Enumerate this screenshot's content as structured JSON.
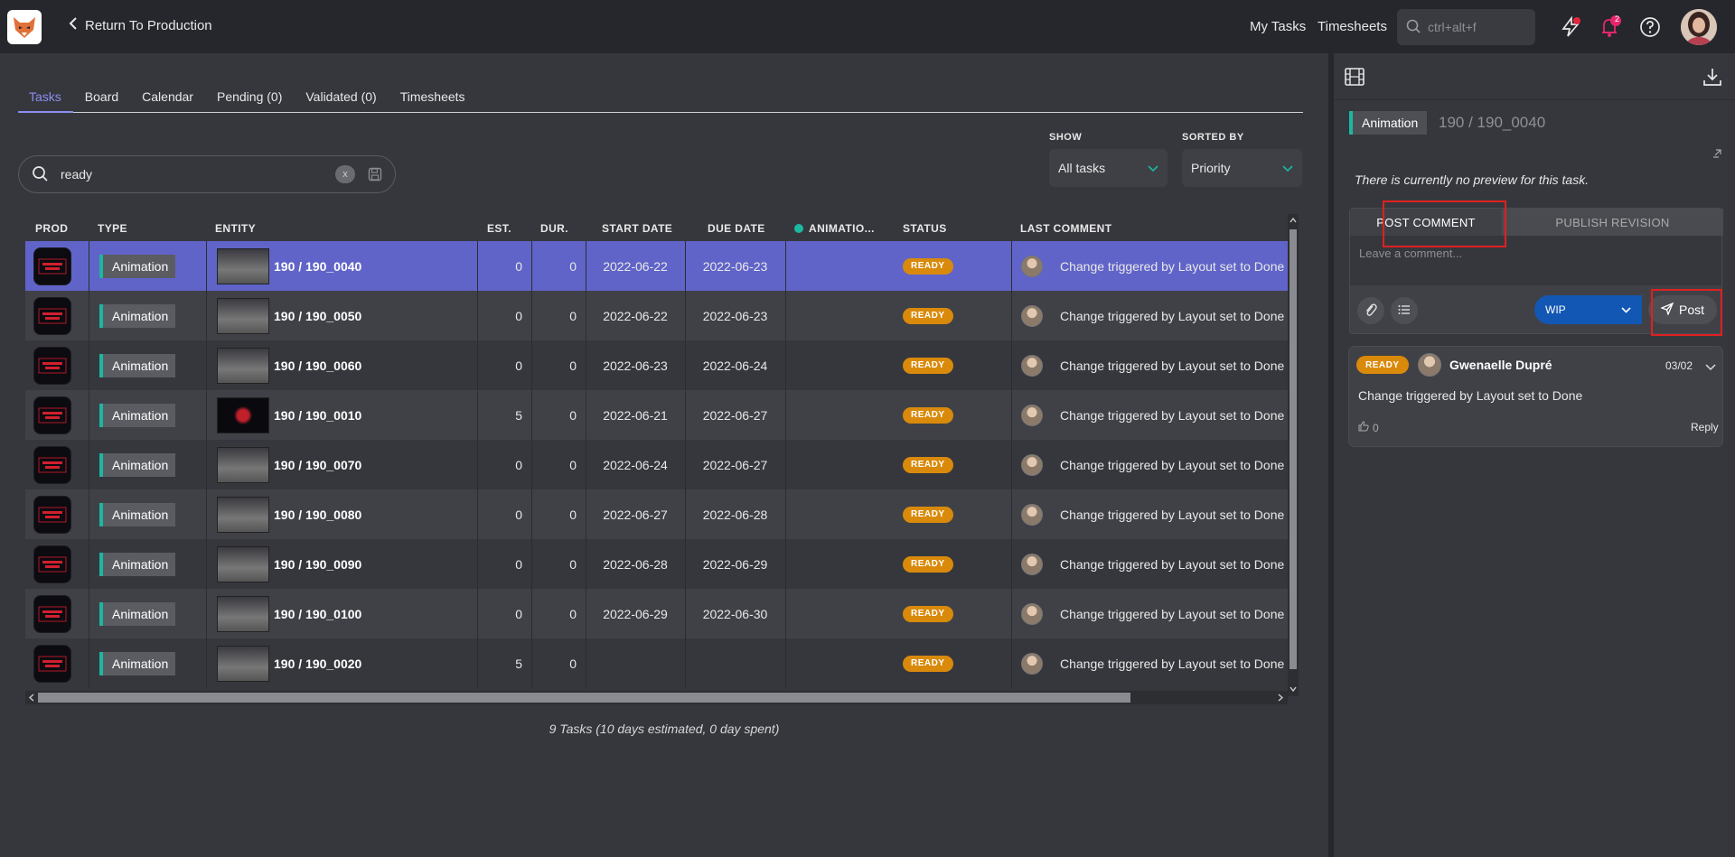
{
  "topbar": {
    "back_label": "Return To Production",
    "my_tasks": "My Tasks",
    "timesheets": "Timesheets",
    "search_placeholder": "ctrl+alt+f",
    "notification_count": "2"
  },
  "tabs": [
    "Tasks",
    "Board",
    "Calendar",
    "Pending (0)",
    "Validated (0)",
    "Timesheets"
  ],
  "filter": {
    "value": "ready",
    "clear": "x"
  },
  "show": {
    "label": "SHOW",
    "value": "All tasks"
  },
  "sorted": {
    "label": "SORTED BY",
    "value": "Priority"
  },
  "columns": {
    "prod": "PROD",
    "type": "TYPE",
    "entity": "ENTITY",
    "est": "EST.",
    "dur": "DUR.",
    "start": "START DATE",
    "due": "DUE DATE",
    "anim": "ANIMATIO...",
    "status": "STATUS",
    "last_comment": "LAST COMMENT"
  },
  "rows": [
    {
      "type": "Animation",
      "entity": "190 / 190_0040",
      "est": "0",
      "dur": "0",
      "start": "2022-06-22",
      "due": "2022-06-23",
      "status": "READY",
      "comment": "Change triggered by Layout set to Done",
      "thumb": "grey"
    },
    {
      "type": "Animation",
      "entity": "190 / 190_0050",
      "est": "0",
      "dur": "0",
      "start": "2022-06-22",
      "due": "2022-06-23",
      "status": "READY",
      "comment": "Change triggered by Layout set to Done",
      "thumb": "grey"
    },
    {
      "type": "Animation",
      "entity": "190 / 190_0060",
      "est": "0",
      "dur": "0",
      "start": "2022-06-23",
      "due": "2022-06-24",
      "status": "READY",
      "comment": "Change triggered by Layout set to Done",
      "thumb": "grey"
    },
    {
      "type": "Animation",
      "entity": "190 / 190_0010",
      "est": "5",
      "dur": "0",
      "start": "2022-06-21",
      "due": "2022-06-27",
      "status": "READY",
      "comment": "Change triggered by Layout set to Done",
      "thumb": "black"
    },
    {
      "type": "Animation",
      "entity": "190 / 190_0070",
      "est": "0",
      "dur": "0",
      "start": "2022-06-24",
      "due": "2022-06-27",
      "status": "READY",
      "comment": "Change triggered by Layout set to Done",
      "thumb": "grey"
    },
    {
      "type": "Animation",
      "entity": "190 / 190_0080",
      "est": "0",
      "dur": "0",
      "start": "2022-06-27",
      "due": "2022-06-28",
      "status": "READY",
      "comment": "Change triggered by Layout set to Done",
      "thumb": "grey"
    },
    {
      "type": "Animation",
      "entity": "190 / 190_0090",
      "est": "0",
      "dur": "0",
      "start": "2022-06-28",
      "due": "2022-06-29",
      "status": "READY",
      "comment": "Change triggered by Layout set to Done",
      "thumb": "grey"
    },
    {
      "type": "Animation",
      "entity": "190 / 190_0100",
      "est": "0",
      "dur": "0",
      "start": "2022-06-29",
      "due": "2022-06-30",
      "status": "READY",
      "comment": "Change triggered by Layout set to Done",
      "thumb": "grey"
    },
    {
      "type": "Animation",
      "entity": "190 / 190_0020",
      "est": "5",
      "dur": "0",
      "start": "",
      "due": "",
      "status": "READY",
      "comment": "Change triggered by Layout set to Done",
      "thumb": "grey"
    }
  ],
  "summary": "9 Tasks (10 days estimated, 0 day spent)",
  "panel": {
    "task_type": "Animation",
    "title": "190 / 190_0040",
    "no_preview": "There is currently no preview for this task.",
    "tab_post": "POST COMMENT",
    "tab_publish": "PUBLISH REVISION",
    "placeholder": "Leave a comment...",
    "status_value": "WIP",
    "post_label": "Post"
  },
  "comment": {
    "status": "READY",
    "author": "Gwenaelle Dupré",
    "date": "03/02",
    "body": "Change triggered by Layout set to Done",
    "likes": "0",
    "reply": "Reply"
  },
  "colors": {
    "accent": "#6064c8",
    "ready": "#d98a0b",
    "task_type": "#1bb7a0",
    "wip": "#1357b4"
  }
}
